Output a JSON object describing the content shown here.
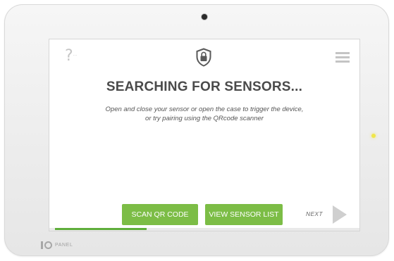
{
  "header": {
    "help_icon": "question-mark-icon",
    "lock_icon": "shield-lock-icon",
    "menu_icon": "hamburger-menu-icon"
  },
  "main": {
    "title": "SEARCHING FOR SENSORS...",
    "instruction_line1": "Open and close your sensor or open the case to trigger the device,",
    "instruction_line2": "or try pairing using the QRcode scanner"
  },
  "footer": {
    "scan_qr_label": "SCAN QR CODE",
    "view_list_label": "VIEW SENSOR LIST",
    "next_label": "NEXT",
    "progress_percent": 30
  },
  "device": {
    "brand_text": "PANEL"
  },
  "colors": {
    "accent": "#7cbd46",
    "progress": "#5fae3b",
    "indicator_led": "#f0e64a"
  }
}
